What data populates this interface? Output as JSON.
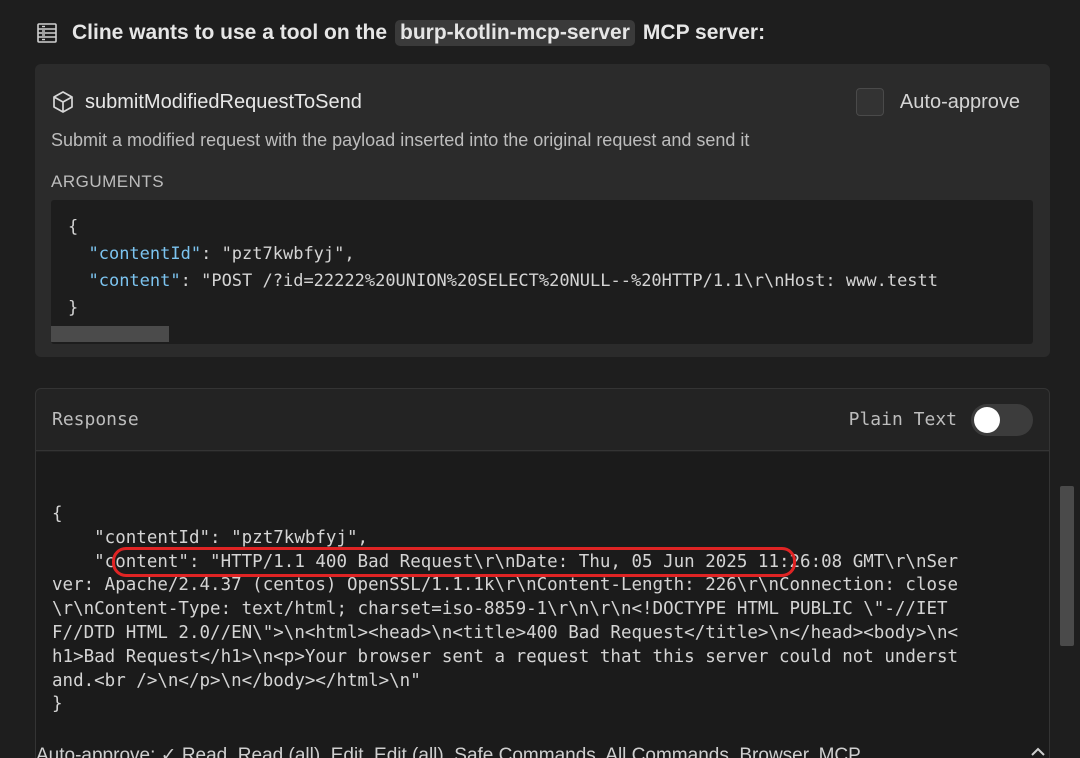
{
  "header": {
    "prefix": "Cline wants to use a tool on the",
    "server": "burp-kotlin-mcp-server",
    "suffix": "MCP server:"
  },
  "tool": {
    "name": "submitModifiedRequestToSend",
    "auto_approve_label": "Auto-approve",
    "auto_approve_checked": false,
    "description": "Submit a modified request with the payload inserted into the original request and send it",
    "arguments_label": "ARGUMENTS",
    "arguments": {
      "open": "{",
      "contentId_key": "\"contentId\"",
      "contentId_value": "\"pzt7kwbfyj\",",
      "content_key": "\"content\"",
      "content_value": "\"POST /?id=22222%20UNION%20SELECT%20NULL--%20HTTP/1.1\\r\\nHost: www.testt",
      "close": "}"
    }
  },
  "response": {
    "title": "Response",
    "plain_text_label": "Plain Text",
    "plain_text_enabled": false,
    "lines": [
      "{",
      "    \"contentId\": \"pzt7kwbfyj\",",
      "    \"content\": \"HTTP/1.1 400 Bad Request\\r\\nDate: Thu, 05 Jun 2025 11:26:08 GMT\\r\\nSer",
      "ver: Apache/2.4.37 (centos) OpenSSL/1.1.1k\\r\\nContent-Length: 226\\r\\nConnection: close",
      "\\r\\nContent-Type: text/html; charset=iso-8859-1\\r\\n\\r\\n<!DOCTYPE HTML PUBLIC \\\"-//IET",
      "F//DTD HTML 2.0//EN\\\">\\n<html><head>\\n<title>400 Bad Request</title>\\n</head><body>\\n<",
      "h1>Bad Request</h1>\\n<p>Your browser sent a request that this server could not underst",
      "and.<br />\\n</p>\\n</body></html>\\n\"",
      "}"
    ]
  },
  "bottom_bar": {
    "text": "Auto-approve:  ✓ Read, Read (all), Edit, Edit (all), Safe Commands, All Commands, Browser, MCP"
  },
  "colors": {
    "background": "#1e1e1e",
    "json_key": "#7cc4f0",
    "highlight": "#e02424"
  }
}
